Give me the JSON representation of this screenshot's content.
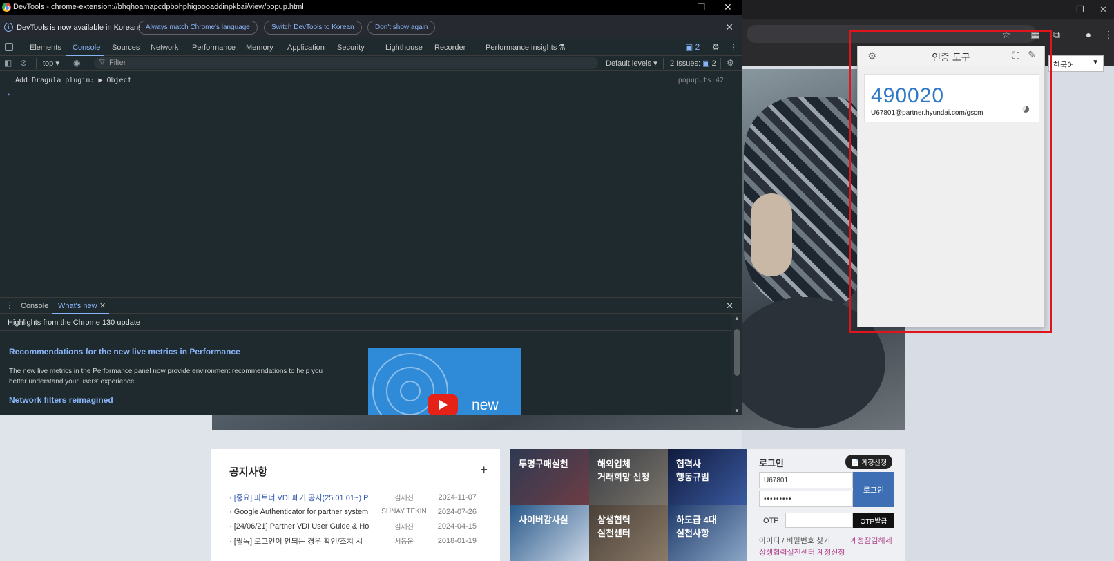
{
  "devtools": {
    "window_title": "DevTools - chrome-extension://bhqhoamapcdpbohphigoooaddinpkbai/view/popup.html",
    "infobar": {
      "message": "DevTools is now available in Korean!",
      "btn_match": "Always match Chrome's language",
      "btn_switch": "Switch DevTools to Korean",
      "btn_dont_show": "Don't show again"
    },
    "tabs": [
      "Elements",
      "Console",
      "Sources",
      "Network",
      "Performance",
      "Memory",
      "Application",
      "Security",
      "Lighthouse",
      "Recorder",
      "Performance insights"
    ],
    "active_tab": "Console",
    "message_count": "2",
    "console_toolbar": {
      "context": "top",
      "filter_placeholder": "Filter",
      "levels": "Default levels",
      "issues_label": "2 Issues:",
      "issues_count": "2"
    },
    "console_log": {
      "message": "Add Dragula plugin: ",
      "object": "▶ Object",
      "source": "popup.ts:42",
      "prompt": "›"
    },
    "drawer": {
      "tabs": [
        "Console",
        "What's new"
      ],
      "active_tab": "What's new",
      "highlights": "Highlights from the Chrome 130 update",
      "heading1": "Recommendations for the new live metrics in Performance",
      "paragraph": "The new live metrics in the Performance panel now provide environment recommendations to help you better understand your users' experience.",
      "heading2": "Network filters reimagined",
      "video_label": "new"
    }
  },
  "authenticator": {
    "title": "인증 도구",
    "code": "490020",
    "account": "U67801@partner.hyundai.com/gscm"
  },
  "browser": {
    "language_select": "한국어"
  },
  "portal": {
    "notice": {
      "title": "공지사항",
      "plus": "+",
      "rows": [
        {
          "title": "· [중요] 파트너 VDI 폐기 공지(25.01.01~) P",
          "author": "김세진",
          "date": "2024-11-07"
        },
        {
          "title": "· Google Authenticator for partner system",
          "author": "SUNAY TEKIN",
          "date": "2024-07-26"
        },
        {
          "title": "· [24/06/21] Partner VDI User Guide & Ho",
          "author": "김세진",
          "date": "2024-04-15"
        },
        {
          "title": "· [필독] 로그인이 안되는 경우 확인/조치 시",
          "author": "서동운",
          "date": "2018-01-19"
        }
      ]
    },
    "tiles": [
      "투명구매실천",
      "해외업체\n거래희망 신청",
      "협력사\n행동규범",
      "사이버감사실",
      "상생협력\n실천센터",
      "하도급 4대\n실천사항"
    ],
    "login": {
      "title": "로그인",
      "account_request": "계정신청",
      "user_id": "U67801",
      "password": "•••••••••",
      "login_button": "로그인",
      "otp_label": "OTP",
      "otp_button": "OTP발급",
      "find_link": "아이디 / 비밀번호 찾기",
      "unlock_link": "계정잠김해제",
      "coop_link": "상생협력실천센터 계정신청"
    }
  },
  "colors": {
    "devtools_bg": "#1e2a2e",
    "accent": "#8ab4f8",
    "otp_code": "#3079c6",
    "highlight": "#e0141b"
  }
}
